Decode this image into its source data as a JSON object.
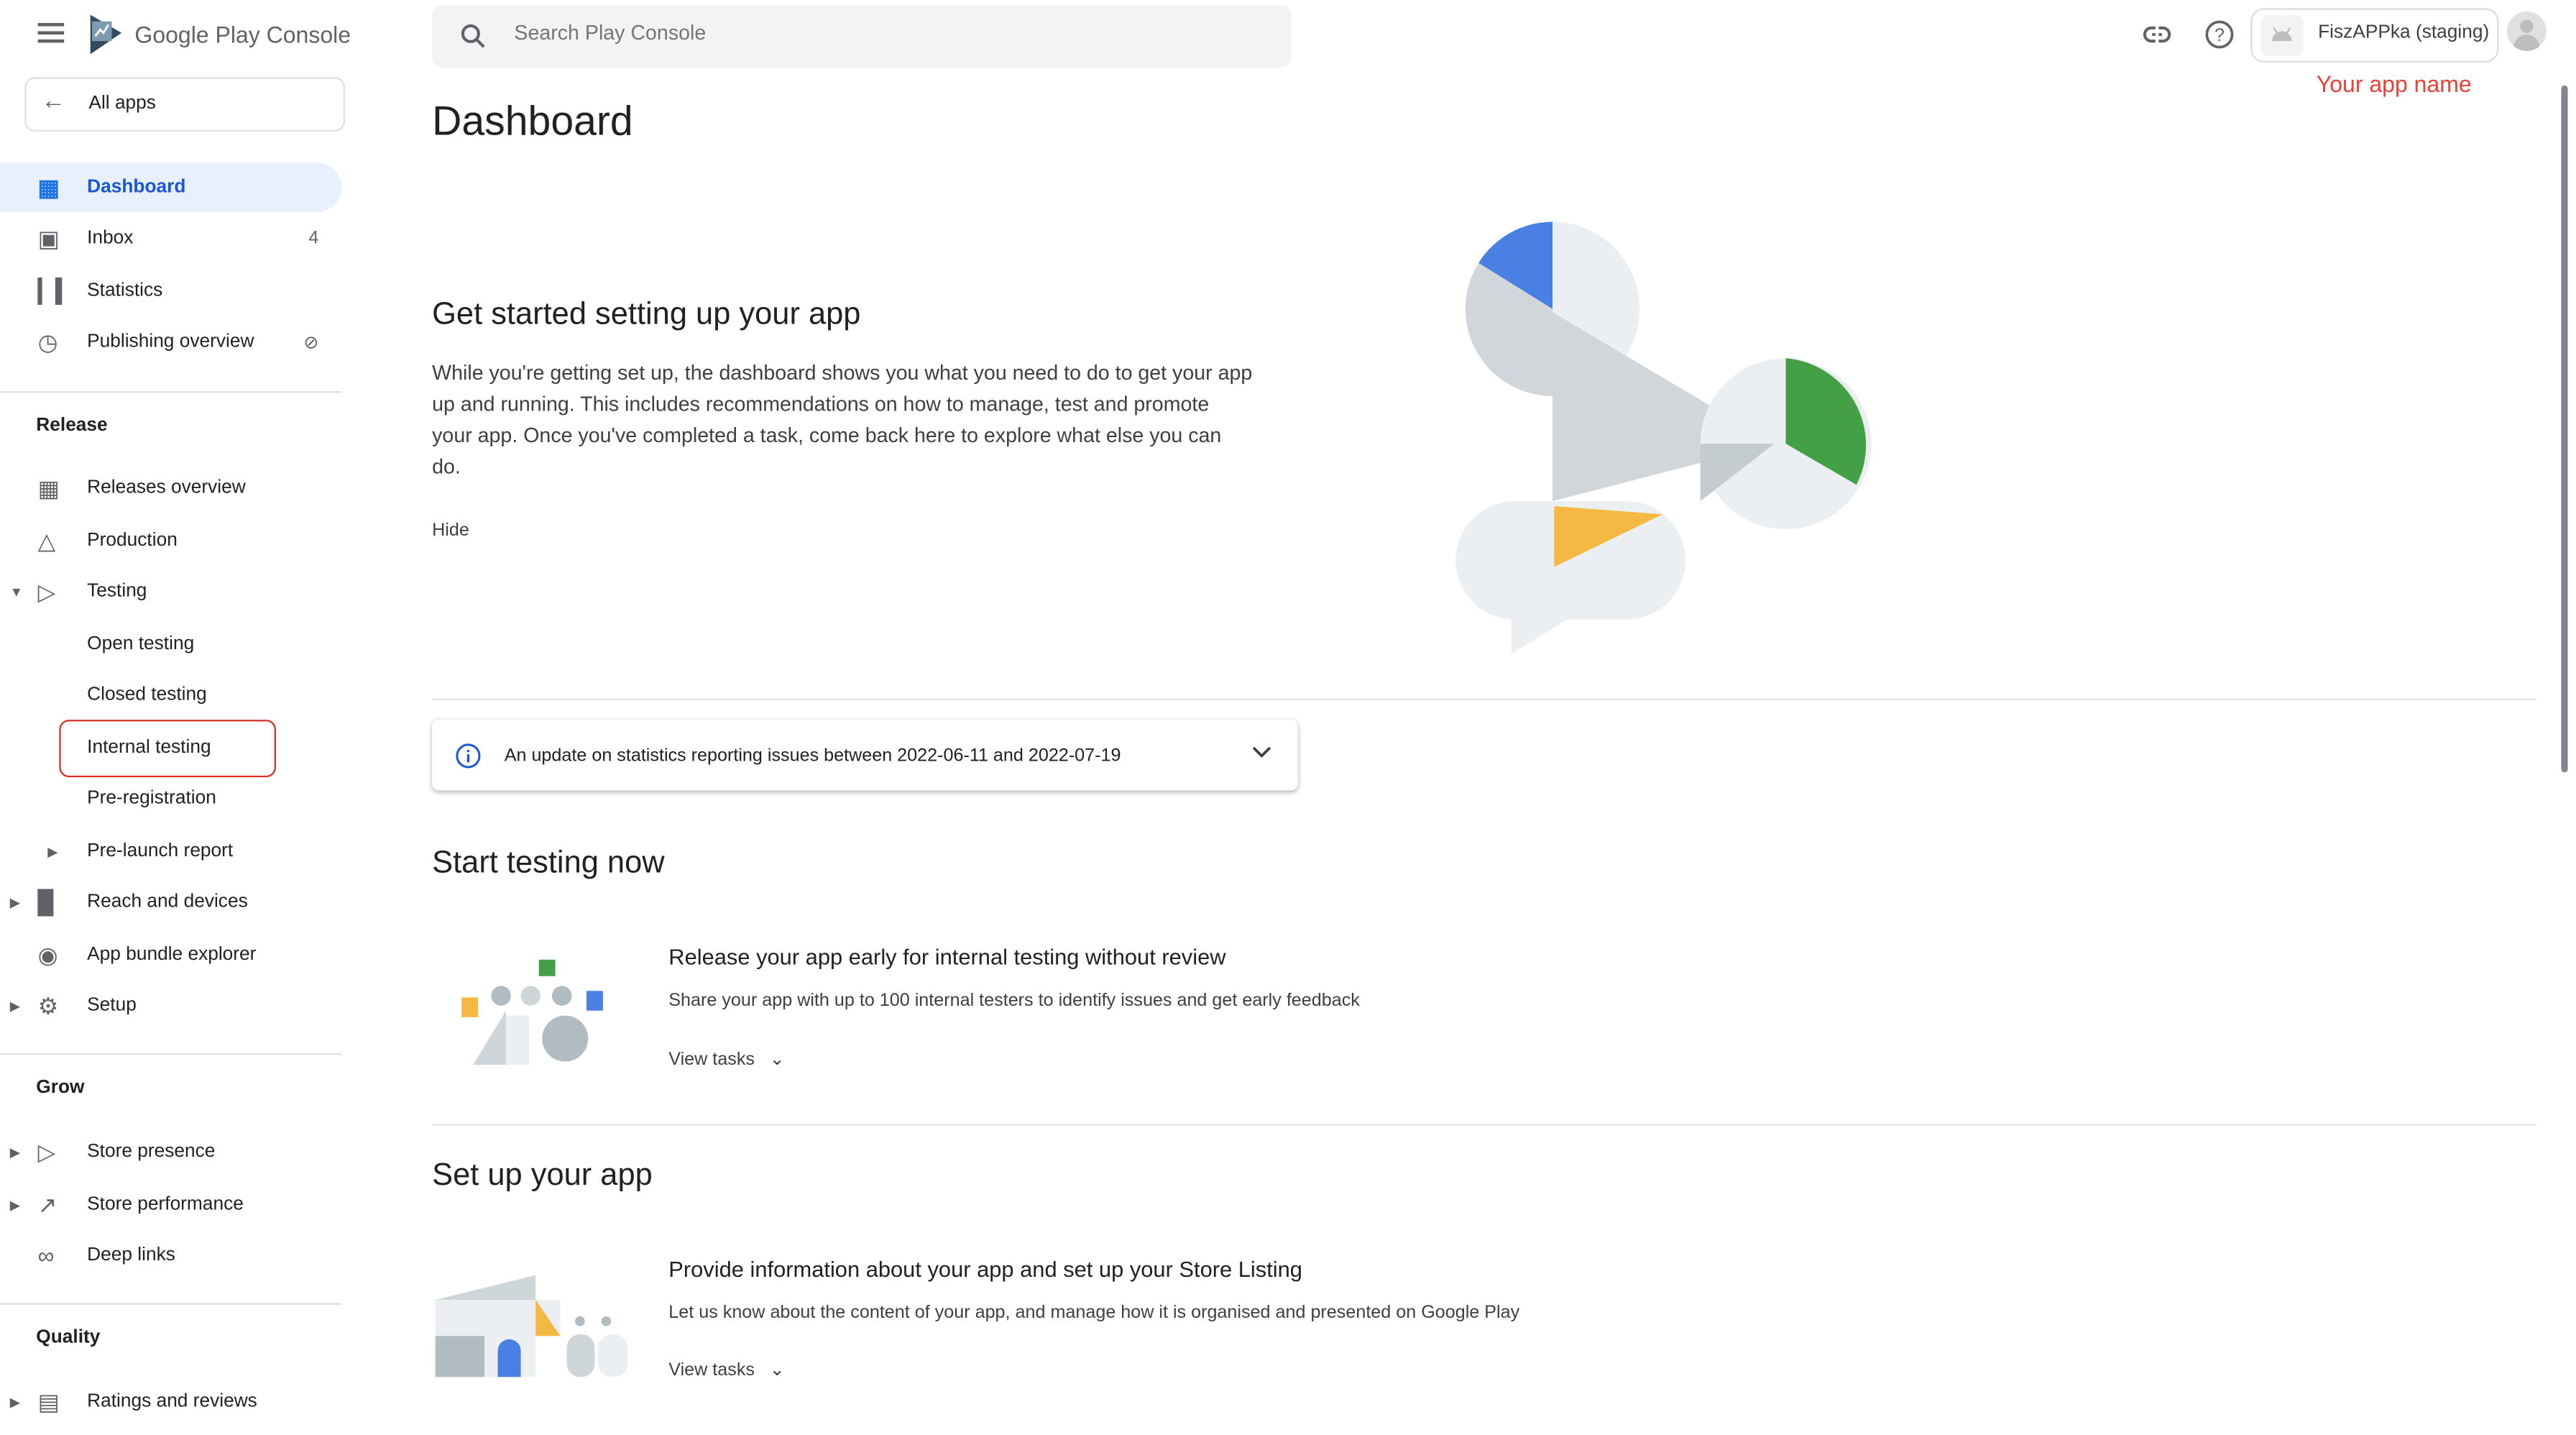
{
  "header": {
    "product_name": "Google Play Console",
    "search_placeholder": "Search Play Console",
    "app_name": "FiszAPPka (staging)",
    "annotation": "Your app name",
    "annotation_color": "#ea4335"
  },
  "sidebar": {
    "all_apps": "All apps",
    "items": [
      {
        "label": "Dashboard",
        "icon": "dashboard-icon",
        "active": true
      },
      {
        "label": "Inbox",
        "icon": "inbox-icon",
        "badge": "4"
      },
      {
        "label": "Statistics",
        "icon": "bar-chart-icon"
      },
      {
        "label": "Publishing overview",
        "icon": "publishing-clock-icon",
        "extra_icon": "sync-disabled-icon"
      },
      {
        "section": "Release"
      },
      {
        "label": "Releases overview",
        "icon": "grid-icon"
      },
      {
        "label": "Production",
        "icon": "production-icon"
      },
      {
        "label": "Testing",
        "icon": "play-circle-icon",
        "caret": "expanded"
      },
      {
        "label": "Open testing",
        "sub": true
      },
      {
        "label": "Closed testing",
        "sub": true
      },
      {
        "label": "Internal testing",
        "sub": true,
        "highlighted": true
      },
      {
        "label": "Pre-registration",
        "sub": true
      },
      {
        "label": "Pre-launch report",
        "sub": true,
        "caret": "collapsed"
      },
      {
        "label": "Reach and devices",
        "icon": "reach-icon",
        "caret": "collapsed"
      },
      {
        "label": "App bundle explorer",
        "icon": "android-icon"
      },
      {
        "label": "Setup",
        "icon": "gear-icon",
        "caret": "collapsed"
      },
      {
        "section": "Grow"
      },
      {
        "label": "Store presence",
        "icon": "play-icon",
        "caret": "collapsed"
      },
      {
        "label": "Store performance",
        "icon": "trending-up-icon",
        "caret": "collapsed"
      },
      {
        "label": "Deep links",
        "icon": "link-icon"
      },
      {
        "section": "Quality"
      },
      {
        "label": "Ratings and reviews",
        "icon": "reviews-icon",
        "caret": "collapsed"
      }
    ]
  },
  "main": {
    "title": "Dashboard",
    "intro": {
      "heading": "Get started setting up your app",
      "body": "While you're getting set up, the dashboard shows you what you need to do to get your app up and running. This includes recommendations on how to manage, test and promote your app. Once you've completed a task, come back here to explore what else you can do.",
      "hide": "Hide"
    },
    "notice": "An update on statistics reporting issues between 2022-06-11 and 2022-07-19",
    "sections": [
      {
        "heading": "Start testing now",
        "task_title": "Release your app early for internal testing without review",
        "task_desc": "Share your app with up to 100 internal testers to identify issues and get early feedback",
        "action": "View tasks"
      },
      {
        "heading": "Set up your app",
        "task_title": "Provide information about your app and set up your Store Listing",
        "task_desc": "Let us know about the content of your app, and manage how it is organised and presented on Google Play",
        "action": "View tasks"
      }
    ]
  },
  "colors": {
    "accent": "#1a73e8",
    "active_bg": "#e8f0fe",
    "green": "#34a853",
    "yellow": "#fbbc04",
    "blue": "#4285f4",
    "highlight_box": "#d93025"
  }
}
